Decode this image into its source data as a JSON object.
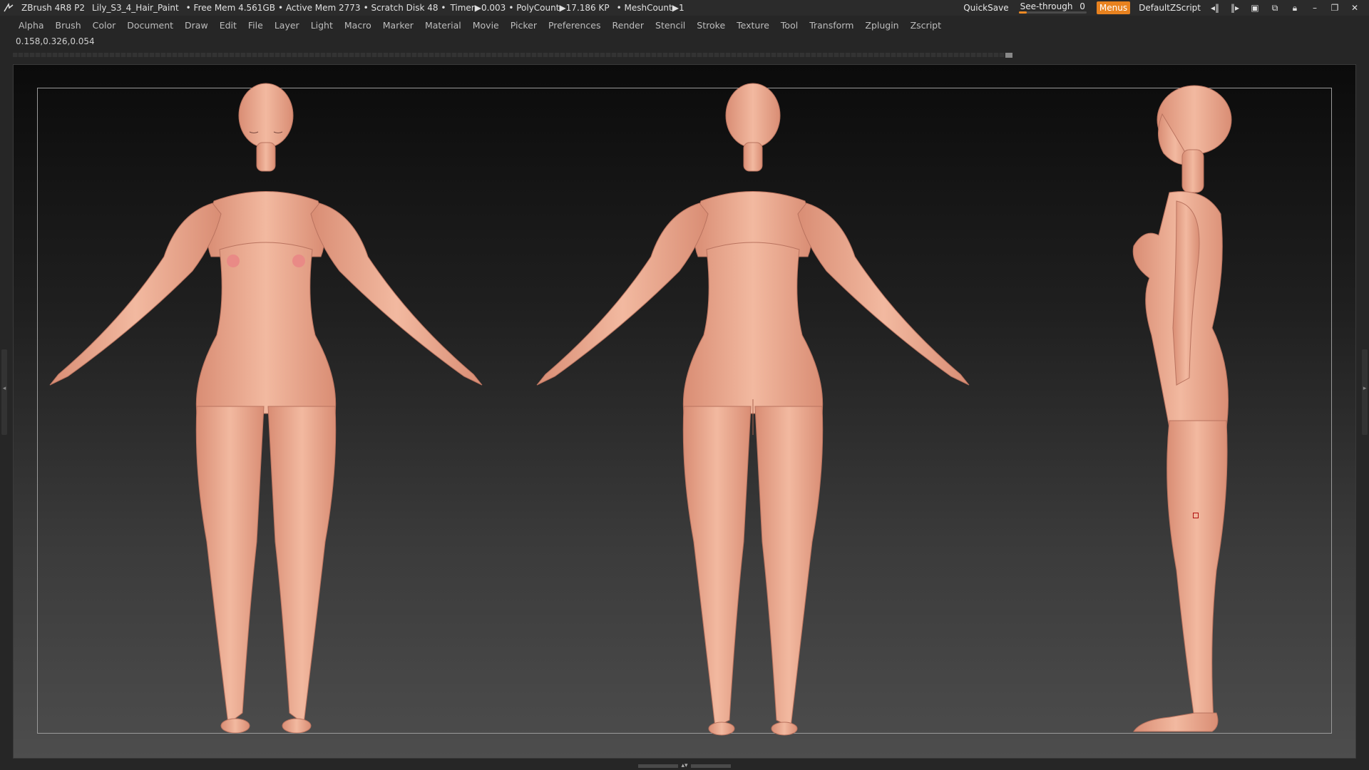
{
  "title_bar": {
    "app": "ZBrush 4R8 P2",
    "file": "Lily_S3_4_Hair_Paint",
    "free_mem": "• Free Mem 4.561GB",
    "active_mem": "• Active Mem 2773",
    "scratch": "• Scratch Disk 48 •",
    "timer": "Timer▶0.003",
    "polycount": "• PolyCount▶17.186 KP",
    "meshcount": "• MeshCount▶1",
    "quicksave": "QuickSave",
    "see_through_label": "See-through",
    "see_through_value": "0",
    "menus": "Menus",
    "script": "DefaultZScript"
  },
  "menu": [
    "Alpha",
    "Brush",
    "Color",
    "Document",
    "Draw",
    "Edit",
    "File",
    "Layer",
    "Light",
    "Macro",
    "Marker",
    "Material",
    "Movie",
    "Picker",
    "Preferences",
    "Render",
    "Stencil",
    "Stroke",
    "Texture",
    "Tool",
    "Transform",
    "Zplugin",
    "Zscript"
  ],
  "readout": "0.158,0.326,0.054",
  "colors": {
    "accent": "#e8821f",
    "skin": "#e9a88f",
    "skin_shadow": "#c9806a"
  }
}
